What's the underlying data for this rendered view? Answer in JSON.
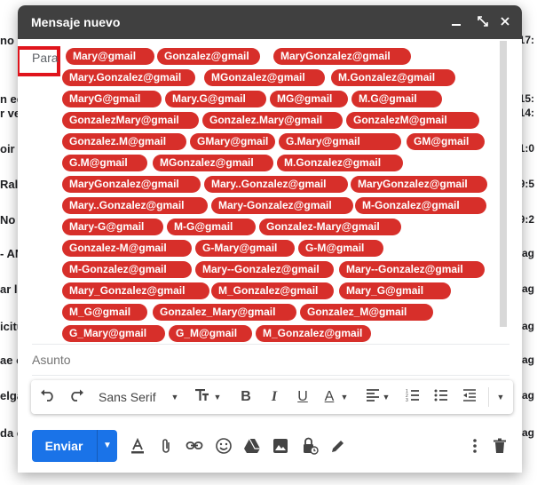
{
  "background_rows": [
    {
      "left": "no c",
      "right": "17:"
    },
    {
      "left": "n eq",
      "right": "15:"
    },
    {
      "left": "r ver",
      "right": "14:"
    },
    {
      "left": "oir u",
      "right": "11:0"
    },
    {
      "left": "Ral",
      "right": "9:5"
    },
    {
      "left": "No h",
      "right": "9:2"
    },
    {
      "left": "- AN",
      "right": "ag"
    },
    {
      "left": "ar la",
      "right": "ag"
    },
    {
      "left": "icitu",
      "right": "ag"
    },
    {
      "left": "ae o",
      "right": "ag"
    },
    {
      "left": "elga",
      "right": "ag"
    },
    {
      "left": "da c",
      "right": "ag"
    }
  ],
  "compose": {
    "title": "Mensaje nuevo",
    "header_icons": [
      "minimize-icon",
      "expand-icon",
      "close-icon"
    ],
    "to_label": "Para",
    "recipients": [
      "Mary@gmail",
      "Gonzalez@gmail",
      "MaryGonzalez@gmail",
      "Mary.Gonzalez@gmail",
      "MGonzalez@gmail",
      "M.Gonzalez@gmail",
      "MaryG@gmail",
      "Mary.G@gmail",
      "MG@gmail",
      "M.G@gmail",
      "GonzalezMary@gmail",
      "Gonzalez.Mary@gmail",
      "GonzalezM@gmail",
      "Gonzalez.M@gmail",
      "GMary@gmail",
      "G.Mary@gmail",
      "GM@gmail",
      "G.M@gmail",
      "MGonzalez@gmail",
      "M.Gonzalez@gmail",
      "MaryGonzalez@gmail",
      "Mary..Gonzalez@gmail",
      "MaryGonzalez@gmail",
      "Mary..Gonzalez@gmail",
      "Mary-Gonzalez@gmail",
      "M-Gonzalez@gmail",
      "Mary-G@gmail",
      "M-G@gmail",
      "Gonzalez-Mary@gmail",
      "Gonzalez-M@gmail",
      "G-Mary@gmail",
      "G-M@gmail",
      "M-Gonzalez@gmail",
      "Mary--Gonzalez@gmail",
      "Mary--Gonzalez@gmail",
      "Mary_Gonzalez@gmail",
      "M_Gonzalez@gmail",
      "Mary_G@gmail",
      "M_G@gmail",
      "Gonzalez_Mary@gmail",
      "Gonzalez_M@gmail",
      "G_Mary@gmail",
      "G_M@gmail",
      "M_Gonzalez@gmail"
    ],
    "subject_placeholder": "Asunto",
    "formatting": {
      "font": "Sans Serif",
      "icons": [
        "undo-icon",
        "redo-icon",
        "font-size-icon",
        "bold-icon",
        "italic-icon",
        "underline-icon",
        "text-color-icon",
        "align-icon",
        "numbered-list-icon",
        "bulleted-list-icon",
        "indent-less-icon",
        "more-formatting-icon"
      ]
    },
    "send_label": "Enviar",
    "bottom_icons": [
      "format-text-icon",
      "attach-icon",
      "link-icon",
      "emoji-icon",
      "drive-icon",
      "photo-icon",
      "confidential-icon",
      "signature-icon",
      "more-options-icon",
      "trash-icon"
    ],
    "chip_color": "#d72f2a",
    "highlight_color": "#e0141c",
    "send_color": "#1a73e8"
  }
}
